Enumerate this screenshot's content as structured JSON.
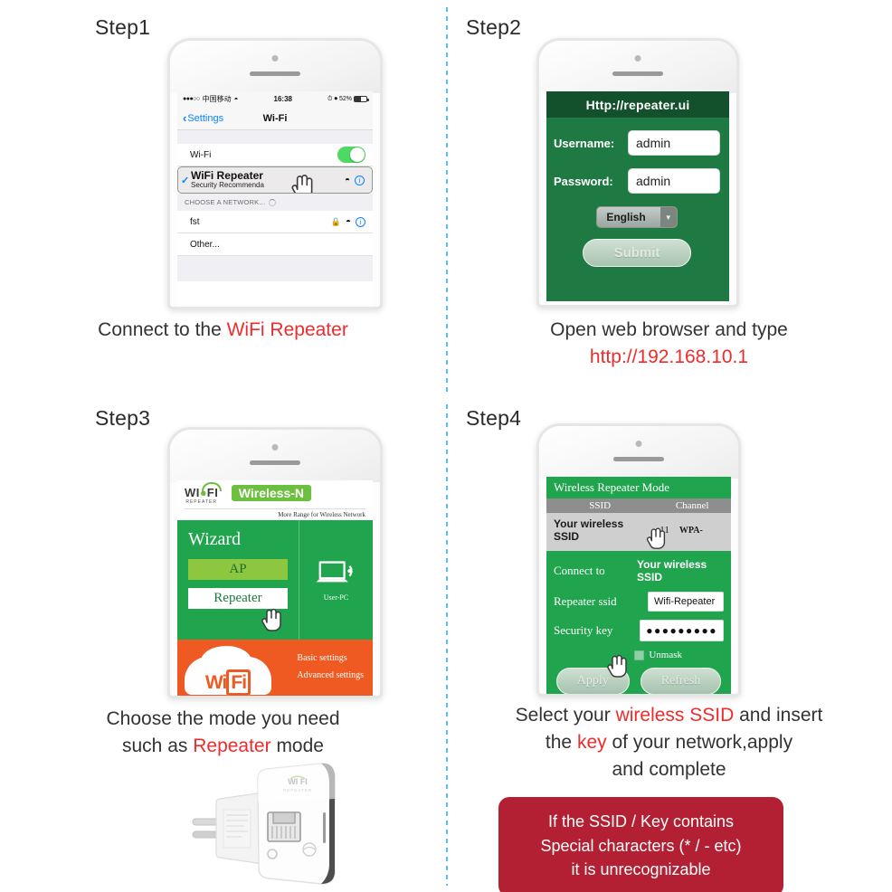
{
  "steps": [
    {
      "label": "Step1"
    },
    {
      "label": "Step2"
    },
    {
      "label": "Step3"
    },
    {
      "label": "Step4"
    }
  ],
  "step1": {
    "status_bar": {
      "signal_dots": "●●●○○",
      "carrier": "中国移动",
      "wifi_icon": "wifi-icon",
      "time": "16:38",
      "battery_percent": "52%",
      "alarm_icon": "alarm-icon",
      "lock_rotation_icon": "rotation-lock-icon"
    },
    "nav": {
      "back_label": "Settings",
      "title": "Wi-Fi"
    },
    "rows": {
      "wifi_toggle_label": "Wi-Fi",
      "wifi_toggle_state": "on",
      "connected_name": "WiFi Repeater",
      "connected_sub": "Security Recommenda",
      "section_header": "CHOOSE A NETWORK...",
      "network2_name": "fst",
      "other_label": "Other..."
    },
    "caption_plain": "Connect to the ",
    "caption_red": "WiFi Repeater"
  },
  "step2": {
    "url_bar": "Http://repeater.ui",
    "username_label": "Username:",
    "username_value": "admin",
    "password_label": "Password:",
    "password_value": "admin",
    "language_value": "English",
    "submit_label": "Submit",
    "caption_line1": "Open web browser and type",
    "caption_line2_red": "http://192.168.10.1"
  },
  "step3": {
    "logo_wi": "WI",
    "logo_fi": "FI",
    "logo_sub": "REPEATER",
    "badge": "Wireless-N",
    "tagline": "More Range for Wireless Network",
    "wizard_title": "Wizard",
    "btn_ap": "AP",
    "btn_repeater": "Repeater",
    "pc_label": "User-PC",
    "wifi_logo_text_1": "Wi",
    "wifi_logo_text_2": "Fi",
    "link_basic": "Basic settings",
    "link_advanced": "Advanced settings",
    "caption_line1": "Choose the mode you need",
    "caption_line2_pre": "such as ",
    "caption_line2_red": "Repeater",
    "caption_line2_post": " mode"
  },
  "step4": {
    "title": "Wireless Repeater Mode",
    "table_headers": [
      "SSID",
      "Channel"
    ],
    "table_row": {
      "ssid": "Your wireless SSID",
      "channel": "11",
      "security": "WPA-"
    },
    "connect_to_label": "Connect to",
    "connect_to_value": "Your wireless SSID",
    "repeater_ssid_label": "Repeater ssid",
    "repeater_ssid_value": "Wifi-Repeater",
    "security_key_label": "Security key",
    "security_key_value": "●●●●●●●●●",
    "unmask_label": "Unmask",
    "btn_apply": "Apply",
    "btn_refresh": "Refresh",
    "caption_pre": "Select your ",
    "caption_red1": "wireless SSID",
    "caption_mid": " and insert",
    "caption_line2_pre": "the ",
    "caption_red2": "key",
    "caption_line2_post": " of your network,apply",
    "caption_line3": "and complete",
    "warning_line1": "If the SSID / Key contains",
    "warning_line2": "Special characters (* / - etc)",
    "warning_line3": "it is unrecognizable"
  },
  "colors": {
    "red_accent": "#ef2b2b",
    "green_ui": "#21a44e",
    "dark_green": "#13502c",
    "orange": "#ef5a22",
    "warning_bg": "#b32033",
    "ios_blue": "#0a84ff",
    "divider_blue": "#4fc3f7"
  }
}
